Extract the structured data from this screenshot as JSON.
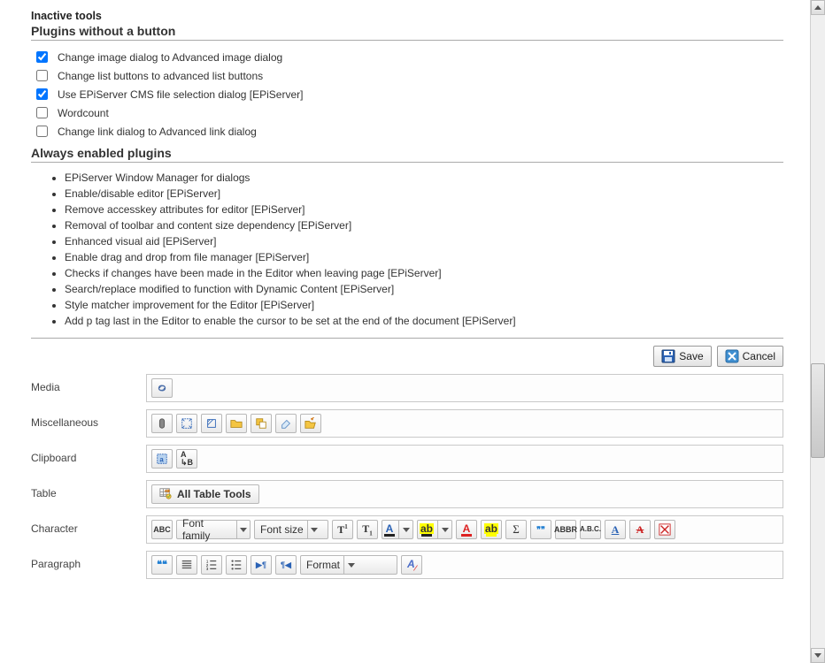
{
  "headings": {
    "inactive_tools": "Inactive tools",
    "plugins_without_button": "Plugins without a button",
    "always_enabled_plugins": "Always enabled plugins"
  },
  "plugins_without_button": [
    {
      "label": "Change image dialog to Advanced image dialog",
      "checked": true
    },
    {
      "label": "Change list buttons to advanced list buttons",
      "checked": false
    },
    {
      "label": "Use EPiServer CMS file selection dialog [EPiServer]",
      "checked": true
    },
    {
      "label": "Wordcount",
      "checked": false
    },
    {
      "label": "Change link dialog to Advanced link dialog",
      "checked": false
    }
  ],
  "always_enabled_plugins": [
    "EPiServer Window Manager for dialogs",
    "Enable/disable editor [EPiServer]",
    "Remove accesskey attributes for editor [EPiServer]",
    "Removal of toolbar and content size dependency [EPiServer]",
    "Enhanced visual aid [EPiServer]",
    "Enable drag and drop from file manager [EPiServer]",
    "Checks if changes have been made in the Editor when leaving page [EPiServer]",
    "Search/replace modified to function with Dynamic Content [EPiServer]",
    "Style matcher improvement for the Editor [EPiServer]",
    "Add p tag last in the Editor to enable the cursor to be set at the end of the document [EPiServer]"
  ],
  "buttons": {
    "save": "Save",
    "cancel": "Cancel"
  },
  "categories": {
    "media": "Media",
    "miscellaneous": "Miscellaneous",
    "clipboard": "Clipboard",
    "table": "Table",
    "character": "Character",
    "paragraph": "Paragraph"
  },
  "tool_labels": {
    "all_table_tools": "All Table Tools",
    "font_family": "Font family",
    "font_size": "Font size",
    "format": "Format",
    "abc": "ABC",
    "abbr": "ABBR",
    "abc_dots": "A.B.C.",
    "quote_open": "❝❝",
    "quote99": "❞❞",
    "abc_lower": "abc",
    "pilcrow_left": "¶◀",
    "pilcrow_right": "▶¶",
    "sigma": "Σ"
  },
  "chart_data": null
}
